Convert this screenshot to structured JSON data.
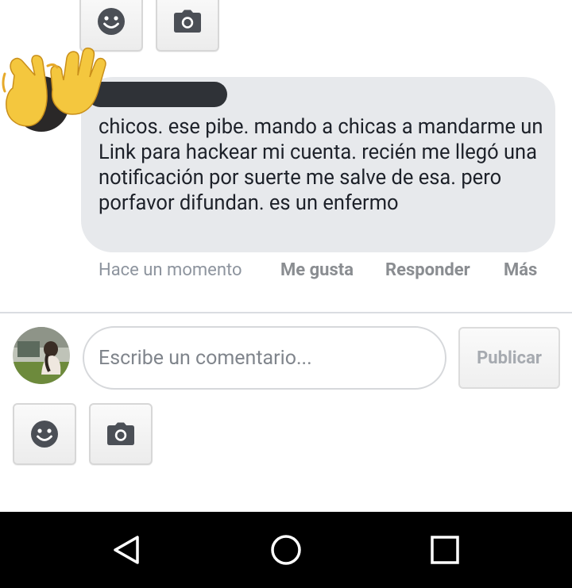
{
  "comment": {
    "text": "chicos. ese pibe. mando a chicas a mandarme un Link para hackear mi cuenta. recién me llegó una notificación por suerte me salve de esa. pero porfavor difundan. es un enfermo",
    "time": "Hace un momento",
    "actions": {
      "like": "Me gusta",
      "reply": "Responder",
      "more": "Más"
    }
  },
  "composer": {
    "placeholder": "Escribe un comentario...",
    "publish_label": "Publicar"
  },
  "icons": {
    "top_smiley": "smiley-icon",
    "top_camera": "camera-icon",
    "bottom_smiley": "smiley-icon",
    "bottom_camera": "camera-icon",
    "overlay_emoji": "waving-hands-icon"
  },
  "colors": {
    "bubble": "#e7e9ec",
    "icon": "#4b4f56",
    "meta": "#8d949e",
    "navbar": "#000000"
  }
}
